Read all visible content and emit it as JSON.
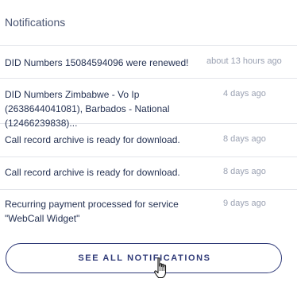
{
  "header": {
    "title": "Notifications"
  },
  "notifications": [
    {
      "text": "DID Numbers 15084594096 were renewed!",
      "time": "about 13 hours ago"
    },
    {
      "text": "DID Numbers Zimbabwe - Vo Ip (2638644041081), Barbados - National (12466239838)...",
      "time": "4 days ago"
    },
    {
      "text": "Call record archive is ready for download.",
      "time": "8 days ago"
    },
    {
      "text": "Call record archive is ready for download.",
      "time": "8 days ago"
    },
    {
      "text": "Recurring payment processed for service \"WebCall Widget\"",
      "time": "9 days ago"
    }
  ],
  "footer": {
    "button_label": "SEE ALL NOTIFICATIONS"
  },
  "colors": {
    "accent": "#2f3a78",
    "text": "#253253",
    "muted": "#9aa1b2",
    "divider": "#e3e5ea"
  },
  "icons": {
    "cursor": "hand-pointer-icon"
  }
}
